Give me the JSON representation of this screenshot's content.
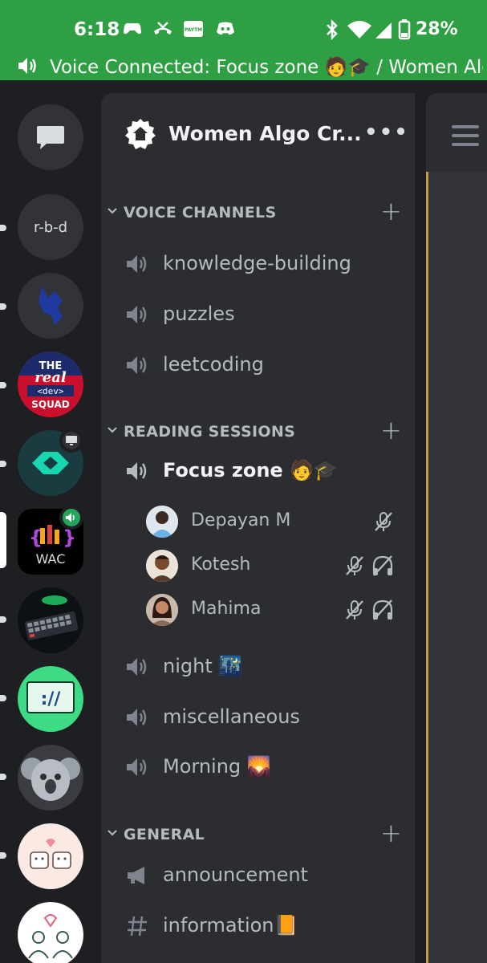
{
  "status_bar": {
    "time": "6:18",
    "battery": "28%",
    "voice_banner": "Voice Connected: Focus zone 🧑🎓 / Women Alg..."
  },
  "servers": [
    {
      "name": "direct-messages",
      "label": ""
    },
    {
      "name": "r-b-d",
      "label": "r-b-d"
    },
    {
      "name": "fox-server",
      "label": ""
    },
    {
      "name": "the-real-dev-squad",
      "label": "THE real <dev> SQUAD"
    },
    {
      "name": "cyan-logo-server",
      "label": ""
    },
    {
      "name": "wac",
      "label": "WAC"
    },
    {
      "name": "keyboard-server",
      "label": ""
    },
    {
      "name": "green-server",
      "label": "://"
    },
    {
      "name": "koala-server",
      "label": ""
    },
    {
      "name": "cute-cats-server",
      "label": ""
    },
    {
      "name": "couple-server",
      "label": ""
    }
  ],
  "guild": {
    "name": "Women Algo Cr...",
    "more": "•••"
  },
  "categories": {
    "voice": "VOICE CHANNELS",
    "reading": "READING SESSIONS",
    "general": "GENERAL"
  },
  "voice_channels": [
    "knowledge-building",
    "puzzles",
    "leetcoding"
  ],
  "reading_channels": {
    "focus": "Focus zone 🧑🎓",
    "night": "night 🌃",
    "misc": "miscellaneous",
    "morning": "Morning 🌄"
  },
  "members": [
    "Depayan M",
    "Kotesh",
    "Mahima"
  ],
  "general_channels": {
    "announcement": "announcement",
    "information": "information📙"
  },
  "colors": {
    "status_bar": "#2ea043",
    "background": "#1e1f22",
    "panel": "#2b2d31",
    "text_muted": "#b5bac1"
  }
}
